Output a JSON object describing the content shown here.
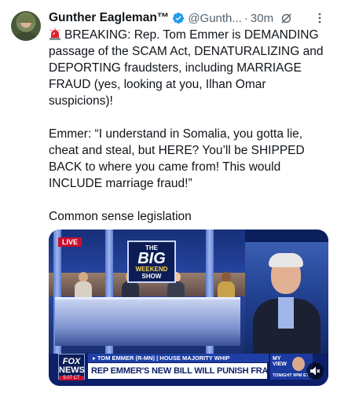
{
  "author": {
    "name": "Gunther Eagleman™",
    "handle": "@Gunth...",
    "separator": "·",
    "time": "30m"
  },
  "icons": {
    "verified": "verified-badge-icon",
    "grok": "grok-icon",
    "more": "more-options-icon",
    "siren": "siren-emoji-icon",
    "mute": "muted-speaker-icon"
  },
  "colors": {
    "verified_blue": "#1d9bf0",
    "muted_text": "#536471",
    "fox_red": "#c8102e",
    "fox_blue": "#0d1f66"
  },
  "tweet": {
    "para1": "BREAKING: Rep. Tom Emmer is DEMANDING passage of the SCAM Act, DENATURALIZING and DEPORTING fraudsters, including MARRIAGE FRAUD (yes, looking at you, Ilhan Omar suspicions)!",
    "para2": "Emmer: “I understand in Somalia, you gotta lie, cheat and steal, but HERE? You’ll be SHIPPED BACK to where you came from! This would INCLUDE marriage fraud!”",
    "para3": "Common sense legislation"
  },
  "video": {
    "live_badge": "LIVE",
    "show_logo": {
      "the": "THE",
      "big": "BIG",
      "weekend": "WEEKEND",
      "show": "SHOW"
    },
    "network": {
      "fox": "FOX",
      "news": "NEWS",
      "clock": "5:07 CT"
    },
    "strap_top": "▸ TOM EMMER (R-MN) | HOUSE MAJORITY WHIP",
    "strap_main": "REP EMMER'S NEW BILL WILL PUNISH FRAUDSTERS",
    "promo": {
      "line1": "MY",
      "line2": "VIEW",
      "tonight": "TONIGHT 9PM ET"
    }
  }
}
